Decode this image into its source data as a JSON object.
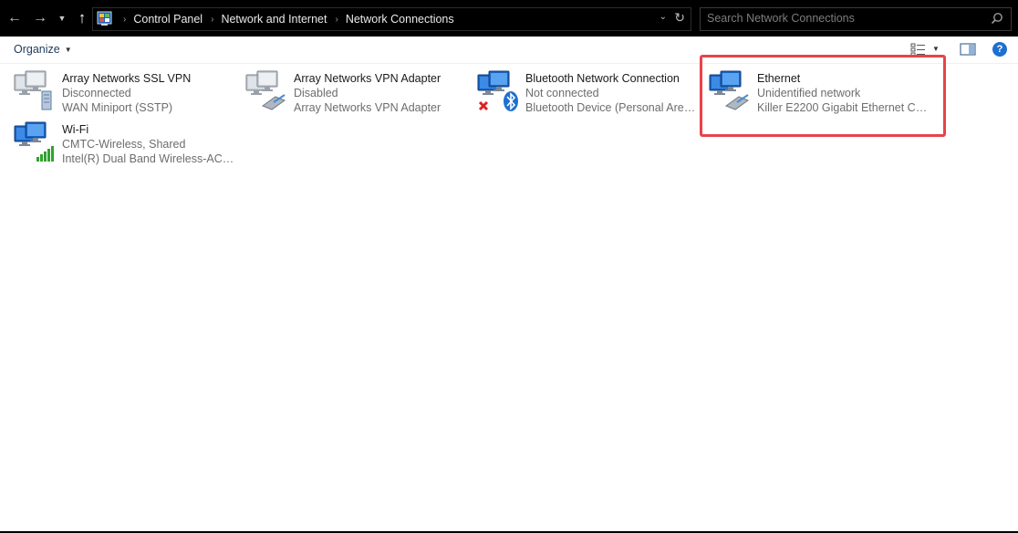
{
  "address_bar": {
    "breadcrumbs": [
      "Control Panel",
      "Network and Internet",
      "Network Connections"
    ],
    "search_placeholder": "Search Network Connections"
  },
  "toolbar": {
    "organize_label": "Organize",
    "help_label": "?"
  },
  "connections": [
    {
      "name": "Array Networks SSL VPN",
      "status": "Disconnected",
      "device": "WAN Miniport (SSTP)",
      "icon": "vpn-network-icon"
    },
    {
      "name": "Array Networks VPN Adapter",
      "status": "Disabled",
      "device": "Array Networks VPN Adapter",
      "icon": "ethernet-network-icon"
    },
    {
      "name": "Bluetooth Network Connection",
      "status": "Not connected",
      "device": "Bluetooth Device (Personal Area ...",
      "icon": "bluetooth-network-icon"
    },
    {
      "name": "Ethernet",
      "status": "Unidentified network",
      "device": "Killer E2200 Gigabit Ethernet Cont...",
      "icon": "ethernet-network-icon"
    },
    {
      "name": "Wi-Fi",
      "status": "CMTC-Wireless, Shared",
      "device": "Intel(R) Dual Band Wireless-AC 72...",
      "icon": "wifi-network-icon"
    }
  ],
  "colors": {
    "titlebar_bg": "#000000",
    "highlight_border": "#e8434a",
    "help_blue": "#1f6fd0",
    "status_text": "#6d6d6d"
  }
}
